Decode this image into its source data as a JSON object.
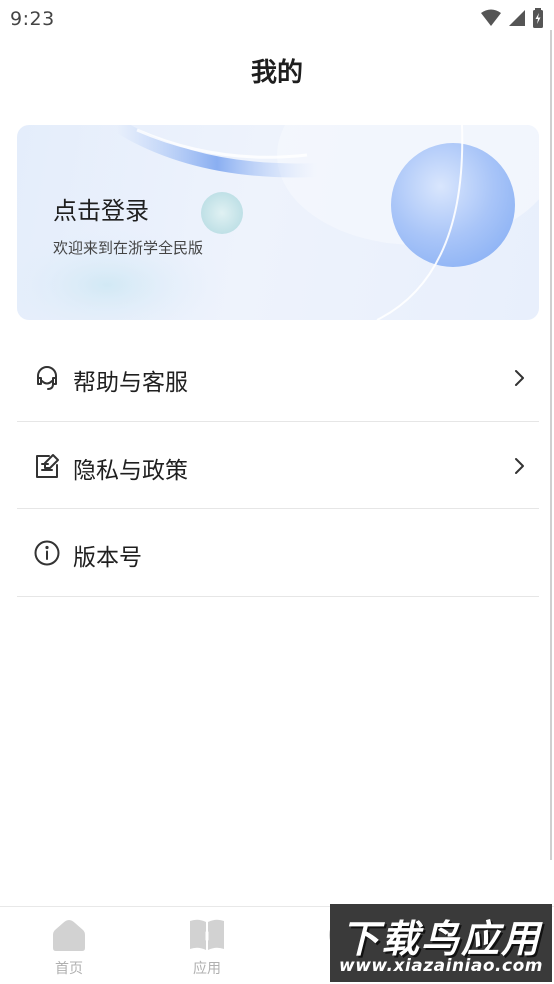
{
  "status_bar": {
    "time": "9:23"
  },
  "header": {
    "title": "我的"
  },
  "login_card": {
    "title": "点击登录",
    "subtitle": "欢迎来到在浙学全民版"
  },
  "menu": {
    "items": [
      {
        "label": "帮助与客服",
        "icon": "headset-icon",
        "has_arrow": true
      },
      {
        "label": "隐私与政策",
        "icon": "document-edit-icon",
        "has_arrow": true
      },
      {
        "label": "版本号",
        "icon": "info-icon",
        "has_arrow": false
      }
    ]
  },
  "tab_bar": {
    "tabs": [
      {
        "label": "首页",
        "icon": "home-icon"
      },
      {
        "label": "应用",
        "icon": "book-icon"
      },
      {
        "label": "",
        "icon": "discover-icon"
      },
      {
        "label": "",
        "icon": "profile-icon"
      }
    ]
  },
  "watermark": {
    "main": "下载鸟应用",
    "url": "www.xiazainiao.com"
  },
  "colors": {
    "text": "#1f1f1f",
    "divider": "#e6e6e6",
    "tab_inactive": "#b0b0b0",
    "card_blue": "#8fb4f5"
  }
}
